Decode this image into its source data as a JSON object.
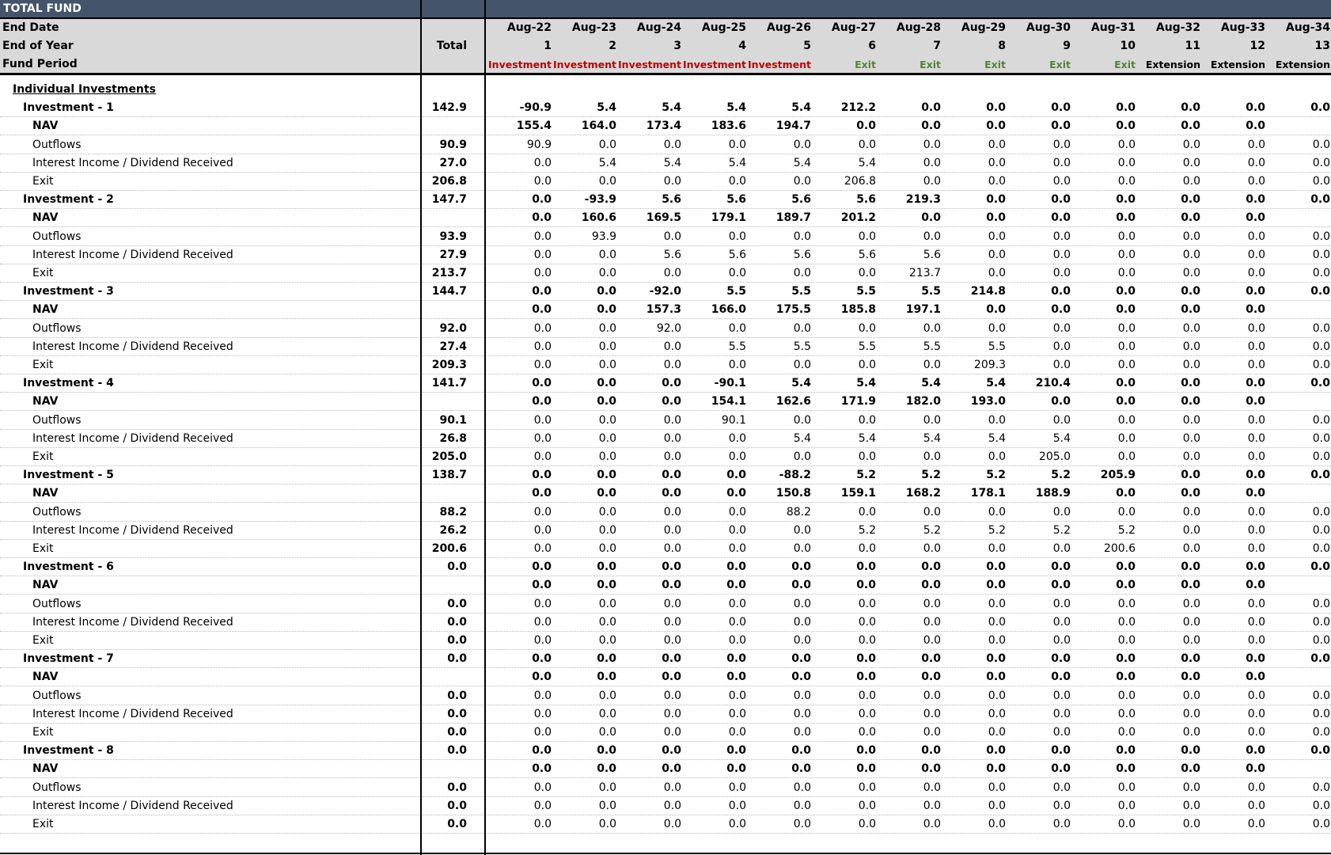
{
  "title": "TOTAL FUND",
  "header": {
    "end_date_label": "End Date",
    "end_of_year_label": "End of Year",
    "fund_period_label": "Fund Period",
    "total_label": "Total",
    "dates": [
      "Aug-22",
      "Aug-23",
      "Aug-24",
      "Aug-25",
      "Aug-26",
      "Aug-27",
      "Aug-28",
      "Aug-29",
      "Aug-30",
      "Aug-31",
      "Aug-32",
      "Aug-33",
      "Aug-34"
    ],
    "years": [
      "1",
      "2",
      "3",
      "4",
      "5",
      "6",
      "7",
      "8",
      "9",
      "10",
      "11",
      "12",
      "13"
    ],
    "periods": [
      "Investment",
      "Investment",
      "Investment",
      "Investment",
      "Investment",
      "Exit",
      "Exit",
      "Exit",
      "Exit",
      "Exit",
      "Extension",
      "Extension",
      "Extension"
    ]
  },
  "period_colors": {
    "Investment": "#c00000",
    "Exit": "#548235",
    "Extension": "#000000"
  },
  "section_label": "Individual Investments",
  "investments": [
    {
      "name": "Investment - 1",
      "total": "142.9",
      "values": [
        "-90.9",
        "5.4",
        "5.4",
        "5.4",
        "5.4",
        "212.2",
        "0.0",
        "0.0",
        "0.0",
        "0.0",
        "0.0",
        "0.0",
        "0.0"
      ],
      "nav": [
        "155.4",
        "164.0",
        "173.4",
        "183.6",
        "194.7",
        "0.0",
        "0.0",
        "0.0",
        "0.0",
        "0.0",
        "0.0",
        "0.0",
        ""
      ],
      "outflows": {
        "total": "90.9",
        "values": [
          "90.9",
          "0.0",
          "0.0",
          "0.0",
          "0.0",
          "0.0",
          "0.0",
          "0.0",
          "0.0",
          "0.0",
          "0.0",
          "0.0",
          "0.0"
        ]
      },
      "income": {
        "total": "27.0",
        "values": [
          "0.0",
          "5.4",
          "5.4",
          "5.4",
          "5.4",
          "5.4",
          "0.0",
          "0.0",
          "0.0",
          "0.0",
          "0.0",
          "0.0",
          "0.0"
        ]
      },
      "exit": {
        "total": "206.8",
        "values": [
          "0.0",
          "0.0",
          "0.0",
          "0.0",
          "0.0",
          "206.8",
          "0.0",
          "0.0",
          "0.0",
          "0.0",
          "0.0",
          "0.0",
          "0.0"
        ]
      }
    },
    {
      "name": "Investment - 2",
      "total": "147.7",
      "values": [
        "0.0",
        "-93.9",
        "5.6",
        "5.6",
        "5.6",
        "5.6",
        "219.3",
        "0.0",
        "0.0",
        "0.0",
        "0.0",
        "0.0",
        "0.0"
      ],
      "nav": [
        "0.0",
        "160.6",
        "169.5",
        "179.1",
        "189.7",
        "201.2",
        "0.0",
        "0.0",
        "0.0",
        "0.0",
        "0.0",
        "0.0",
        ""
      ],
      "outflows": {
        "total": "93.9",
        "values": [
          "0.0",
          "93.9",
          "0.0",
          "0.0",
          "0.0",
          "0.0",
          "0.0",
          "0.0",
          "0.0",
          "0.0",
          "0.0",
          "0.0",
          "0.0"
        ]
      },
      "income": {
        "total": "27.9",
        "values": [
          "0.0",
          "0.0",
          "5.6",
          "5.6",
          "5.6",
          "5.6",
          "5.6",
          "0.0",
          "0.0",
          "0.0",
          "0.0",
          "0.0",
          "0.0"
        ]
      },
      "exit": {
        "total": "213.7",
        "values": [
          "0.0",
          "0.0",
          "0.0",
          "0.0",
          "0.0",
          "0.0",
          "213.7",
          "0.0",
          "0.0",
          "0.0",
          "0.0",
          "0.0",
          "0.0"
        ]
      }
    },
    {
      "name": "Investment - 3",
      "total": "144.7",
      "values": [
        "0.0",
        "0.0",
        "-92.0",
        "5.5",
        "5.5",
        "5.5",
        "5.5",
        "214.8",
        "0.0",
        "0.0",
        "0.0",
        "0.0",
        "0.0"
      ],
      "nav": [
        "0.0",
        "0.0",
        "157.3",
        "166.0",
        "175.5",
        "185.8",
        "197.1",
        "0.0",
        "0.0",
        "0.0",
        "0.0",
        "0.0",
        ""
      ],
      "outflows": {
        "total": "92.0",
        "values": [
          "0.0",
          "0.0",
          "92.0",
          "0.0",
          "0.0",
          "0.0",
          "0.0",
          "0.0",
          "0.0",
          "0.0",
          "0.0",
          "0.0",
          "0.0"
        ]
      },
      "income": {
        "total": "27.4",
        "values": [
          "0.0",
          "0.0",
          "0.0",
          "5.5",
          "5.5",
          "5.5",
          "5.5",
          "5.5",
          "0.0",
          "0.0",
          "0.0",
          "0.0",
          "0.0"
        ]
      },
      "exit": {
        "total": "209.3",
        "values": [
          "0.0",
          "0.0",
          "0.0",
          "0.0",
          "0.0",
          "0.0",
          "0.0",
          "209.3",
          "0.0",
          "0.0",
          "0.0",
          "0.0",
          "0.0"
        ]
      }
    },
    {
      "name": "Investment - 4",
      "total": "141.7",
      "values": [
        "0.0",
        "0.0",
        "0.0",
        "-90.1",
        "5.4",
        "5.4",
        "5.4",
        "5.4",
        "210.4",
        "0.0",
        "0.0",
        "0.0",
        "0.0"
      ],
      "nav": [
        "0.0",
        "0.0",
        "0.0",
        "154.1",
        "162.6",
        "171.9",
        "182.0",
        "193.0",
        "0.0",
        "0.0",
        "0.0",
        "0.0",
        ""
      ],
      "outflows": {
        "total": "90.1",
        "values": [
          "0.0",
          "0.0",
          "0.0",
          "90.1",
          "0.0",
          "0.0",
          "0.0",
          "0.0",
          "0.0",
          "0.0",
          "0.0",
          "0.0",
          "0.0"
        ]
      },
      "income": {
        "total": "26.8",
        "values": [
          "0.0",
          "0.0",
          "0.0",
          "0.0",
          "5.4",
          "5.4",
          "5.4",
          "5.4",
          "5.4",
          "0.0",
          "0.0",
          "0.0",
          "0.0"
        ]
      },
      "exit": {
        "total": "205.0",
        "values": [
          "0.0",
          "0.0",
          "0.0",
          "0.0",
          "0.0",
          "0.0",
          "0.0",
          "0.0",
          "205.0",
          "0.0",
          "0.0",
          "0.0",
          "0.0"
        ]
      }
    },
    {
      "name": "Investment - 5",
      "total": "138.7",
      "values": [
        "0.0",
        "0.0",
        "0.0",
        "0.0",
        "-88.2",
        "5.2",
        "5.2",
        "5.2",
        "5.2",
        "205.9",
        "0.0",
        "0.0",
        "0.0"
      ],
      "nav": [
        "0.0",
        "0.0",
        "0.0",
        "0.0",
        "150.8",
        "159.1",
        "168.2",
        "178.1",
        "188.9",
        "0.0",
        "0.0",
        "0.0",
        ""
      ],
      "outflows": {
        "total": "88.2",
        "values": [
          "0.0",
          "0.0",
          "0.0",
          "0.0",
          "88.2",
          "0.0",
          "0.0",
          "0.0",
          "0.0",
          "0.0",
          "0.0",
          "0.0",
          "0.0"
        ]
      },
      "income": {
        "total": "26.2",
        "values": [
          "0.0",
          "0.0",
          "0.0",
          "0.0",
          "0.0",
          "5.2",
          "5.2",
          "5.2",
          "5.2",
          "5.2",
          "0.0",
          "0.0",
          "0.0"
        ]
      },
      "exit": {
        "total": "200.6",
        "values": [
          "0.0",
          "0.0",
          "0.0",
          "0.0",
          "0.0",
          "0.0",
          "0.0",
          "0.0",
          "0.0",
          "200.6",
          "0.0",
          "0.0",
          "0.0"
        ]
      }
    },
    {
      "name": "Investment - 6",
      "total": "0.0",
      "values": [
        "0.0",
        "0.0",
        "0.0",
        "0.0",
        "0.0",
        "0.0",
        "0.0",
        "0.0",
        "0.0",
        "0.0",
        "0.0",
        "0.0",
        "0.0"
      ],
      "nav": [
        "0.0",
        "0.0",
        "0.0",
        "0.0",
        "0.0",
        "0.0",
        "0.0",
        "0.0",
        "0.0",
        "0.0",
        "0.0",
        "0.0",
        ""
      ],
      "outflows": {
        "total": "0.0",
        "values": [
          "0.0",
          "0.0",
          "0.0",
          "0.0",
          "0.0",
          "0.0",
          "0.0",
          "0.0",
          "0.0",
          "0.0",
          "0.0",
          "0.0",
          "0.0"
        ]
      },
      "income": {
        "total": "0.0",
        "values": [
          "0.0",
          "0.0",
          "0.0",
          "0.0",
          "0.0",
          "0.0",
          "0.0",
          "0.0",
          "0.0",
          "0.0",
          "0.0",
          "0.0",
          "0.0"
        ]
      },
      "exit": {
        "total": "0.0",
        "values": [
          "0.0",
          "0.0",
          "0.0",
          "0.0",
          "0.0",
          "0.0",
          "0.0",
          "0.0",
          "0.0",
          "0.0",
          "0.0",
          "0.0",
          "0.0"
        ]
      }
    },
    {
      "name": "Investment - 7",
      "total": "0.0",
      "values": [
        "0.0",
        "0.0",
        "0.0",
        "0.0",
        "0.0",
        "0.0",
        "0.0",
        "0.0",
        "0.0",
        "0.0",
        "0.0",
        "0.0",
        "0.0"
      ],
      "nav": [
        "0.0",
        "0.0",
        "0.0",
        "0.0",
        "0.0",
        "0.0",
        "0.0",
        "0.0",
        "0.0",
        "0.0",
        "0.0",
        "0.0",
        ""
      ],
      "outflows": {
        "total": "0.0",
        "values": [
          "0.0",
          "0.0",
          "0.0",
          "0.0",
          "0.0",
          "0.0",
          "0.0",
          "0.0",
          "0.0",
          "0.0",
          "0.0",
          "0.0",
          "0.0"
        ]
      },
      "income": {
        "total": "0.0",
        "values": [
          "0.0",
          "0.0",
          "0.0",
          "0.0",
          "0.0",
          "0.0",
          "0.0",
          "0.0",
          "0.0",
          "0.0",
          "0.0",
          "0.0",
          "0.0"
        ]
      },
      "exit": {
        "total": "0.0",
        "values": [
          "0.0",
          "0.0",
          "0.0",
          "0.0",
          "0.0",
          "0.0",
          "0.0",
          "0.0",
          "0.0",
          "0.0",
          "0.0",
          "0.0",
          "0.0"
        ]
      }
    },
    {
      "name": "Investment - 8",
      "total": "0.0",
      "values": [
        "0.0",
        "0.0",
        "0.0",
        "0.0",
        "0.0",
        "0.0",
        "0.0",
        "0.0",
        "0.0",
        "0.0",
        "0.0",
        "0.0",
        "0.0"
      ],
      "nav": [
        "0.0",
        "0.0",
        "0.0",
        "0.0",
        "0.0",
        "0.0",
        "0.0",
        "0.0",
        "0.0",
        "0.0",
        "0.0",
        "0.0",
        ""
      ],
      "outflows": {
        "total": "0.0",
        "values": [
          "0.0",
          "0.0",
          "0.0",
          "0.0",
          "0.0",
          "0.0",
          "0.0",
          "0.0",
          "0.0",
          "0.0",
          "0.0",
          "0.0",
          "0.0"
        ]
      },
      "income": {
        "total": "0.0",
        "values": [
          "0.0",
          "0.0",
          "0.0",
          "0.0",
          "0.0",
          "0.0",
          "0.0",
          "0.0",
          "0.0",
          "0.0",
          "0.0",
          "0.0",
          "0.0"
        ]
      },
      "exit": {
        "total": "0.0",
        "values": [
          "0.0",
          "0.0",
          "0.0",
          "0.0",
          "0.0",
          "0.0",
          "0.0",
          "0.0",
          "0.0",
          "0.0",
          "0.0",
          "0.0",
          "0.0"
        ]
      }
    }
  ],
  "sub_labels": {
    "nav": "NAV",
    "outflows": "Outflows",
    "income": "Interest Income / Dividend Received",
    "exit": "Exit"
  }
}
